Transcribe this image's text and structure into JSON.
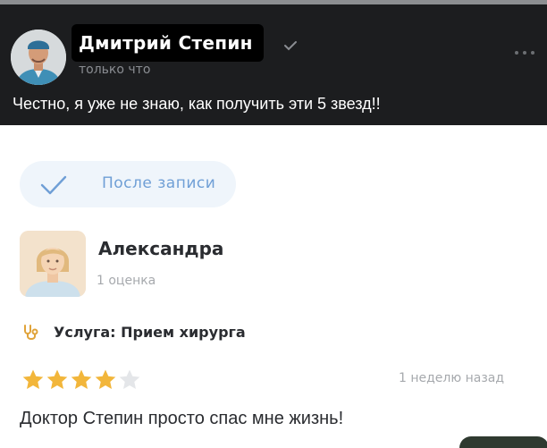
{
  "post": {
    "author_name": "Дмитрий Степин",
    "time": "только что",
    "text": "Честно, я уже не знаю, как получить эти 5 звезд!!",
    "avatar_icon": "doctor-avatar",
    "verified_icon": "check-icon",
    "more_icon": "more-dots-icon"
  },
  "review": {
    "badge_label": "После записи",
    "badge_icon": "check-icon",
    "reviewer_name": "Александра",
    "reviewer_rating_count": "1 оценка",
    "service_icon": "stethoscope-icon",
    "service": "Услуга: Прием хирурга",
    "rating": 4,
    "max_rating": 5,
    "date": "1 неделю назад",
    "text": "Доктор Степин просто спас мне жизнь!"
  },
  "colors": {
    "post_background": "#1c1d1f",
    "star_filled": "#f2b63b",
    "star_empty": "#e4e6e9",
    "badge_text": "#6f9fd6",
    "service_icon": "#e0a33a"
  }
}
